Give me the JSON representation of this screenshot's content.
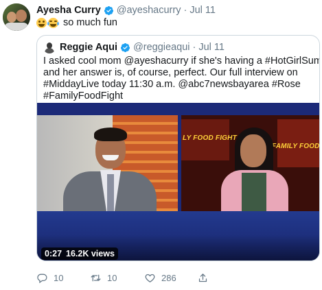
{
  "tweet": {
    "author_name": "Ayesha Curry",
    "handle": "@ayeshacurry",
    "separator": "·",
    "date": "Jul 11",
    "text": "so much fun",
    "emojis": [
      "zany-face-emoji",
      "tears-of-joy-emoji"
    ]
  },
  "quoted": {
    "author_name": "Reggie Aqui",
    "handle": "@reggieaqui",
    "separator": "·",
    "date": "Jul 11",
    "lines": [
      "I asked cool mom @ayeshacurry if she's having a #HotGirlSummer",
      "and her answer is, of course, perfect. Our full interview on",
      "#MiddayLive today 11:30 a.m. @abc7newsbayarea #Rose",
      "#FamilyFoodFight"
    ],
    "video": {
      "duration": "0:27",
      "views": "16.2K views",
      "show_logo_left": "LY FOOD FIGHT",
      "show_logo_right": "FAMILY FOOD FIG"
    }
  },
  "actions": {
    "replies": "10",
    "retweets": "10",
    "likes": "286"
  },
  "colors": {
    "text": "#14171a",
    "secondary": "#657786",
    "verified": "#1da1f2",
    "border": "#ccd6dd"
  }
}
